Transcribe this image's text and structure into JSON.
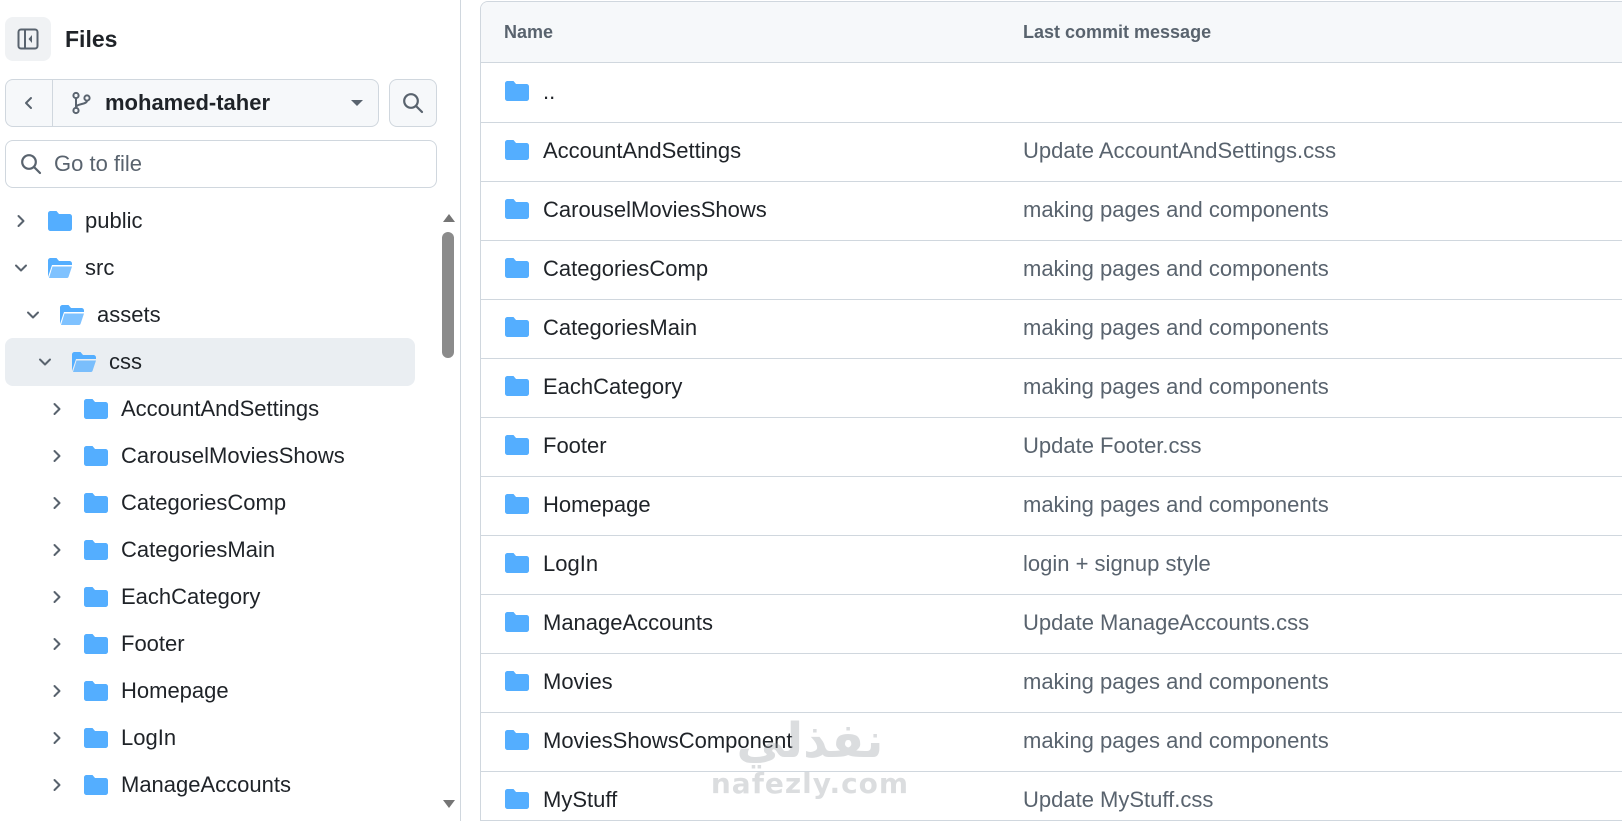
{
  "sidebar": {
    "title": "Files",
    "branch": "mohamed-taher",
    "search_placeholder": "Go to file",
    "tree": [
      {
        "label": "public",
        "depth": 0,
        "expanded": false,
        "selected": false
      },
      {
        "label": "src",
        "depth": 0,
        "expanded": true,
        "selected": false
      },
      {
        "label": "assets",
        "depth": 1,
        "expanded": true,
        "selected": false
      },
      {
        "label": "css",
        "depth": 2,
        "expanded": true,
        "selected": true
      },
      {
        "label": "AccountAndSettings",
        "depth": 3,
        "expanded": false,
        "selected": false
      },
      {
        "label": "CarouselMoviesShows",
        "depth": 3,
        "expanded": false,
        "selected": false
      },
      {
        "label": "CategoriesComp",
        "depth": 3,
        "expanded": false,
        "selected": false
      },
      {
        "label": "CategoriesMain",
        "depth": 3,
        "expanded": false,
        "selected": false
      },
      {
        "label": "EachCategory",
        "depth": 3,
        "expanded": false,
        "selected": false
      },
      {
        "label": "Footer",
        "depth": 3,
        "expanded": false,
        "selected": false
      },
      {
        "label": "Homepage",
        "depth": 3,
        "expanded": false,
        "selected": false
      },
      {
        "label": "LogIn",
        "depth": 3,
        "expanded": false,
        "selected": false
      },
      {
        "label": "ManageAccounts",
        "depth": 3,
        "expanded": false,
        "selected": false
      }
    ]
  },
  "table": {
    "col_name": "Name",
    "col_message": "Last commit message",
    "rows": [
      {
        "name": "..",
        "message": ""
      },
      {
        "name": "AccountAndSettings",
        "message": "Update AccountAndSettings.css"
      },
      {
        "name": "CarouselMoviesShows",
        "message": "making pages and components"
      },
      {
        "name": "CategoriesComp",
        "message": "making pages and components"
      },
      {
        "name": "CategoriesMain",
        "message": "making pages and components"
      },
      {
        "name": "EachCategory",
        "message": "making pages and components"
      },
      {
        "name": "Footer",
        "message": "Update Footer.css"
      },
      {
        "name": "Homepage",
        "message": "making pages and components"
      },
      {
        "name": "LogIn",
        "message": "login + signup style"
      },
      {
        "name": "ManageAccounts",
        "message": "Update ManageAccounts.css"
      },
      {
        "name": "Movies",
        "message": "making pages and components"
      },
      {
        "name": "MoviesShowsComponent",
        "message": "making pages and components"
      },
      {
        "name": "MyStuff",
        "message": "Update MyStuff.css"
      }
    ]
  },
  "watermark": {
    "arabic": "نفذلي",
    "latin": "nafezly.com"
  },
  "colors": {
    "folder": "#54aeff",
    "border": "#d0d7de",
    "muted": "#59636e",
    "selected_bg": "#eaeef2"
  }
}
